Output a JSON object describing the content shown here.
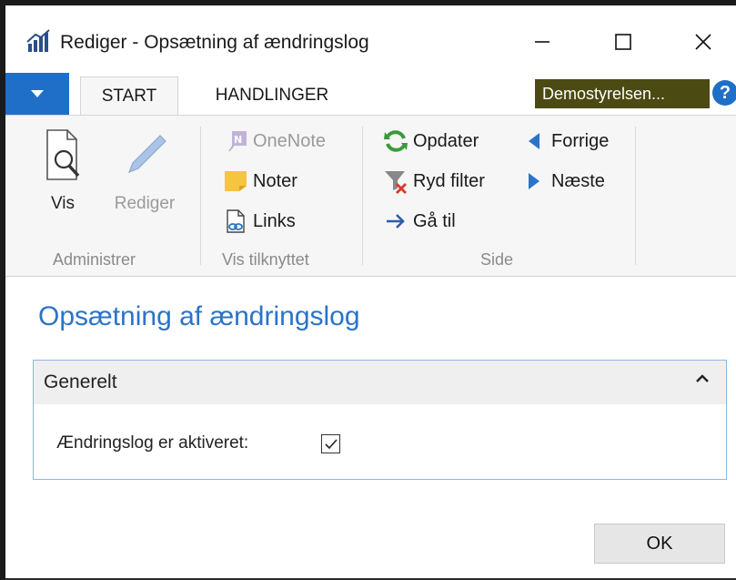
{
  "window": {
    "title": "Rediger - Opsætning af ændringslog",
    "minimize": "—",
    "maximize": "☐",
    "close": "✕"
  },
  "tabs": {
    "start": "START",
    "actions": "HANDLINGER"
  },
  "company": "Demostyrelsen...",
  "help": "?",
  "ribbon": {
    "groups": {
      "manage": {
        "label": "Administrer",
        "view": "Vis",
        "edit": "Rediger"
      },
      "show_attached": {
        "label": "Vis tilknyttet",
        "onenote": "OneNote",
        "notes": "Noter",
        "links": "Links"
      },
      "page": {
        "label": "Side",
        "refresh": "Opdater",
        "clear_filter": "Ryd filter",
        "go_to": "Gå til",
        "previous": "Forrige",
        "next": "Næste"
      }
    }
  },
  "page_title": "Opsætning af ændringslog",
  "fasttab": {
    "title": "Generelt",
    "field_label": "Ændringslog er aktiveret:",
    "checked": true
  },
  "ok_label": "OK",
  "colors": {
    "accent_blue": "#1f6fc8",
    "title_blue": "#2b73c9",
    "company_badge": "#4a4a12"
  }
}
